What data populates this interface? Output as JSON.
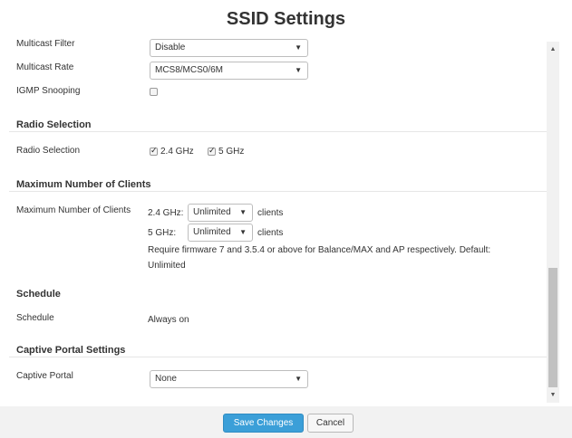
{
  "dialog": {
    "title": "SSID Settings"
  },
  "multicast": {
    "filter_label": "Multicast Filter",
    "filter_value": "Disable",
    "rate_label": "Multicast Rate",
    "rate_value": "MCS8/MCS0/6M",
    "igmp_label": "IGMP Snooping",
    "igmp_checked": false
  },
  "radio": {
    "section_title": "Radio Selection",
    "label": "Radio Selection",
    "options": [
      {
        "label": "2.4 GHz",
        "checked": true
      },
      {
        "label": "5 GHz",
        "checked": true
      }
    ]
  },
  "max_clients": {
    "section_title": "Maximum Number of Clients",
    "label": "Maximum Number of Clients",
    "band_24_label": "2.4 GHz:",
    "band_24_value": "Unlimited",
    "band_5_label": "5 GHz:",
    "band_5_value": "Unlimited",
    "unit": "clients",
    "note_line1": "Require firmware 7 and 3.5.4 or above for Balance/MAX and AP respectively. Default:",
    "note_line2": "Unlimited"
  },
  "schedule": {
    "section_title": "Schedule",
    "label": "Schedule",
    "value": "Always on"
  },
  "captive": {
    "section_title": "Captive Portal Settings",
    "label": "Captive Portal",
    "value": "None"
  },
  "footer": {
    "save_label": "Save Changes",
    "cancel_label": "Cancel"
  },
  "icons": {
    "caret": "▼",
    "scroll_up": "▲",
    "scroll_down": "▼"
  },
  "colors": {
    "primary_button": "#3b9fd8",
    "footer_bg": "#f2f2f2"
  }
}
